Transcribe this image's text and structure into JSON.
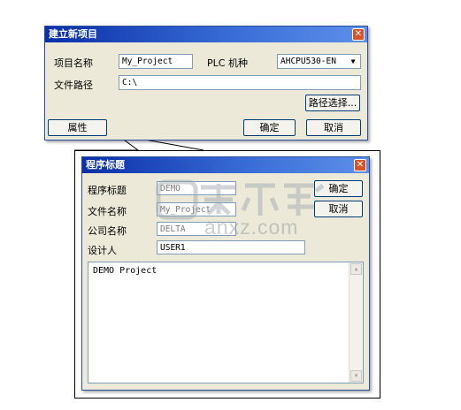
{
  "new_project_dialog": {
    "title": "建立新项目",
    "project_name_label": "项目名称",
    "project_name_value": "My_Project",
    "plc_model_label": "PLC 机种",
    "plc_model_value": "AHCPU530-EN",
    "file_path_label": "文件路径",
    "file_path_value": "C:\\",
    "browse_path_button": "路径选择...",
    "properties_button": "属性",
    "ok_button": "确定",
    "cancel_button": "取消"
  },
  "program_title_dialog": {
    "title": "程序标题",
    "program_title_label": "程序标题",
    "program_title_value": "DEMO",
    "file_name_label": "文件名称",
    "file_name_value": "My_Project",
    "company_label": "公司名称",
    "company_value": "DELTA",
    "designer_label": "设计人",
    "designer_value": "USER1",
    "ok_button": "确定",
    "cancel_button": "取消",
    "description_text": "DEMO Project"
  },
  "watermark": {
    "text": "anxz.com"
  },
  "icons": {
    "close": "close-icon",
    "dropdown": "chevron-down-icon",
    "scroll_up": "scroll-up-icon",
    "scroll_down": "scroll-down-icon"
  }
}
